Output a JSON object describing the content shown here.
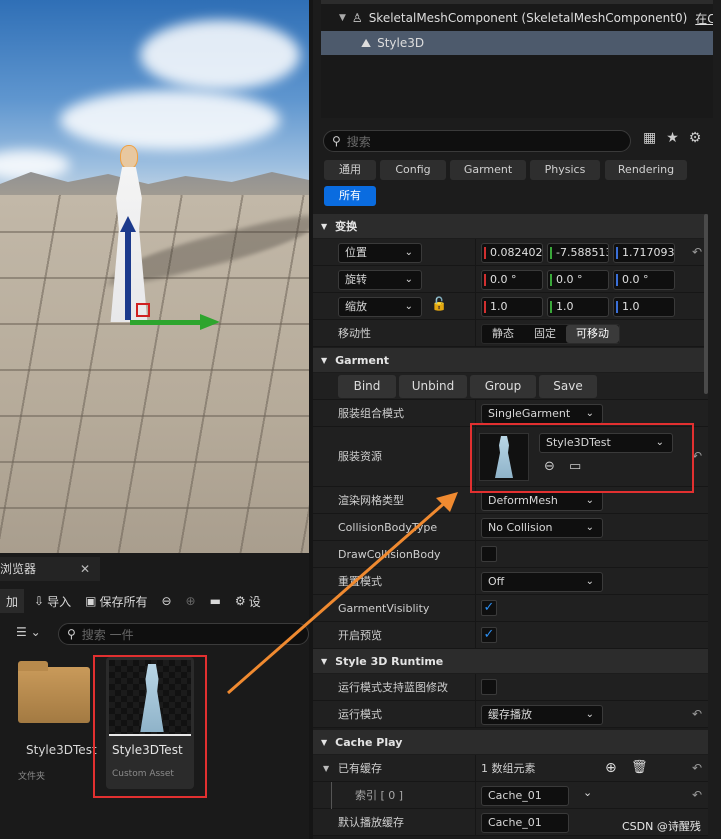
{
  "tree": {
    "component": "SkeletalMeshComponent (SkeletalMeshComponent0)",
    "component_tail": "在C",
    "selected_item": "Style3D"
  },
  "details_search": {
    "placeholder": "搜索"
  },
  "filter_tabs": [
    "通用",
    "Config",
    "Garment",
    "Physics",
    "Rendering",
    "所有"
  ],
  "transform": {
    "section": "变换",
    "location": {
      "label": "位置",
      "x": "0.082402",
      "y": "-7.588513",
      "z": "1.717093"
    },
    "rotation": {
      "label": "旋转",
      "x": "0.0 °",
      "y": "0.0 °",
      "z": "0.0 °"
    },
    "scale": {
      "label": "缩放",
      "x": "1.0",
      "y": "1.0",
      "z": "1.0"
    },
    "mobility": {
      "label": "移动性",
      "options": [
        "静态",
        "固定",
        "可移动"
      ],
      "selected": "可移动"
    }
  },
  "garment": {
    "section": "Garment",
    "buttons": [
      "Bind",
      "Unbind",
      "Group",
      "Save"
    ],
    "combine_mode": {
      "label": "服装组合模式",
      "value": "SingleGarment"
    },
    "asset": {
      "label": "服装资源",
      "value": "Style3DTest"
    },
    "render_mesh_type": {
      "label": "渲染网格类型",
      "value": "DeformMesh"
    },
    "collision_body_type": {
      "label": "CollisionBodyType",
      "value": "No Collision"
    },
    "draw_collision_body": {
      "label": "DrawCollisionBody",
      "checked": false
    },
    "repeat_mode": {
      "label": "重置模式",
      "value": "Off"
    },
    "garment_visibility": {
      "label": "GarmentVisiblity",
      "checked": true
    },
    "enable_preview": {
      "label": "开启预览",
      "checked": true
    }
  },
  "runtime": {
    "section": "Style 3D Runtime",
    "blueprint_edit": {
      "label": "运行模式支持蓝图修改",
      "checked": false
    },
    "run_mode": {
      "label": "运行模式",
      "value": "缓存播放"
    }
  },
  "cache_play": {
    "section": "Cache Play",
    "existing": {
      "label": "已有缓存",
      "value": "1 数组元素"
    },
    "index": {
      "label": "索引 [ 0 ]",
      "value": "Cache_01"
    },
    "default": {
      "label": "默认播放缓存",
      "value": "Cache_01"
    }
  },
  "content_browser": {
    "tab": "浏览器",
    "toolbar": {
      "add": "加",
      "import": "导入",
      "save_all": "保存所有",
      "settings": "设"
    },
    "search_placeholder": "搜索 一件",
    "folder": {
      "name": "Style3DTest",
      "type": "文件夹"
    },
    "asset": {
      "name": "Style3DTest",
      "type": "Custom Asset"
    }
  },
  "watermark": "CSDN @诗醒残",
  "colors": {
    "accent": "#0a6ce0",
    "highlight_box": "#e23030",
    "arrow": "#f08a30"
  }
}
